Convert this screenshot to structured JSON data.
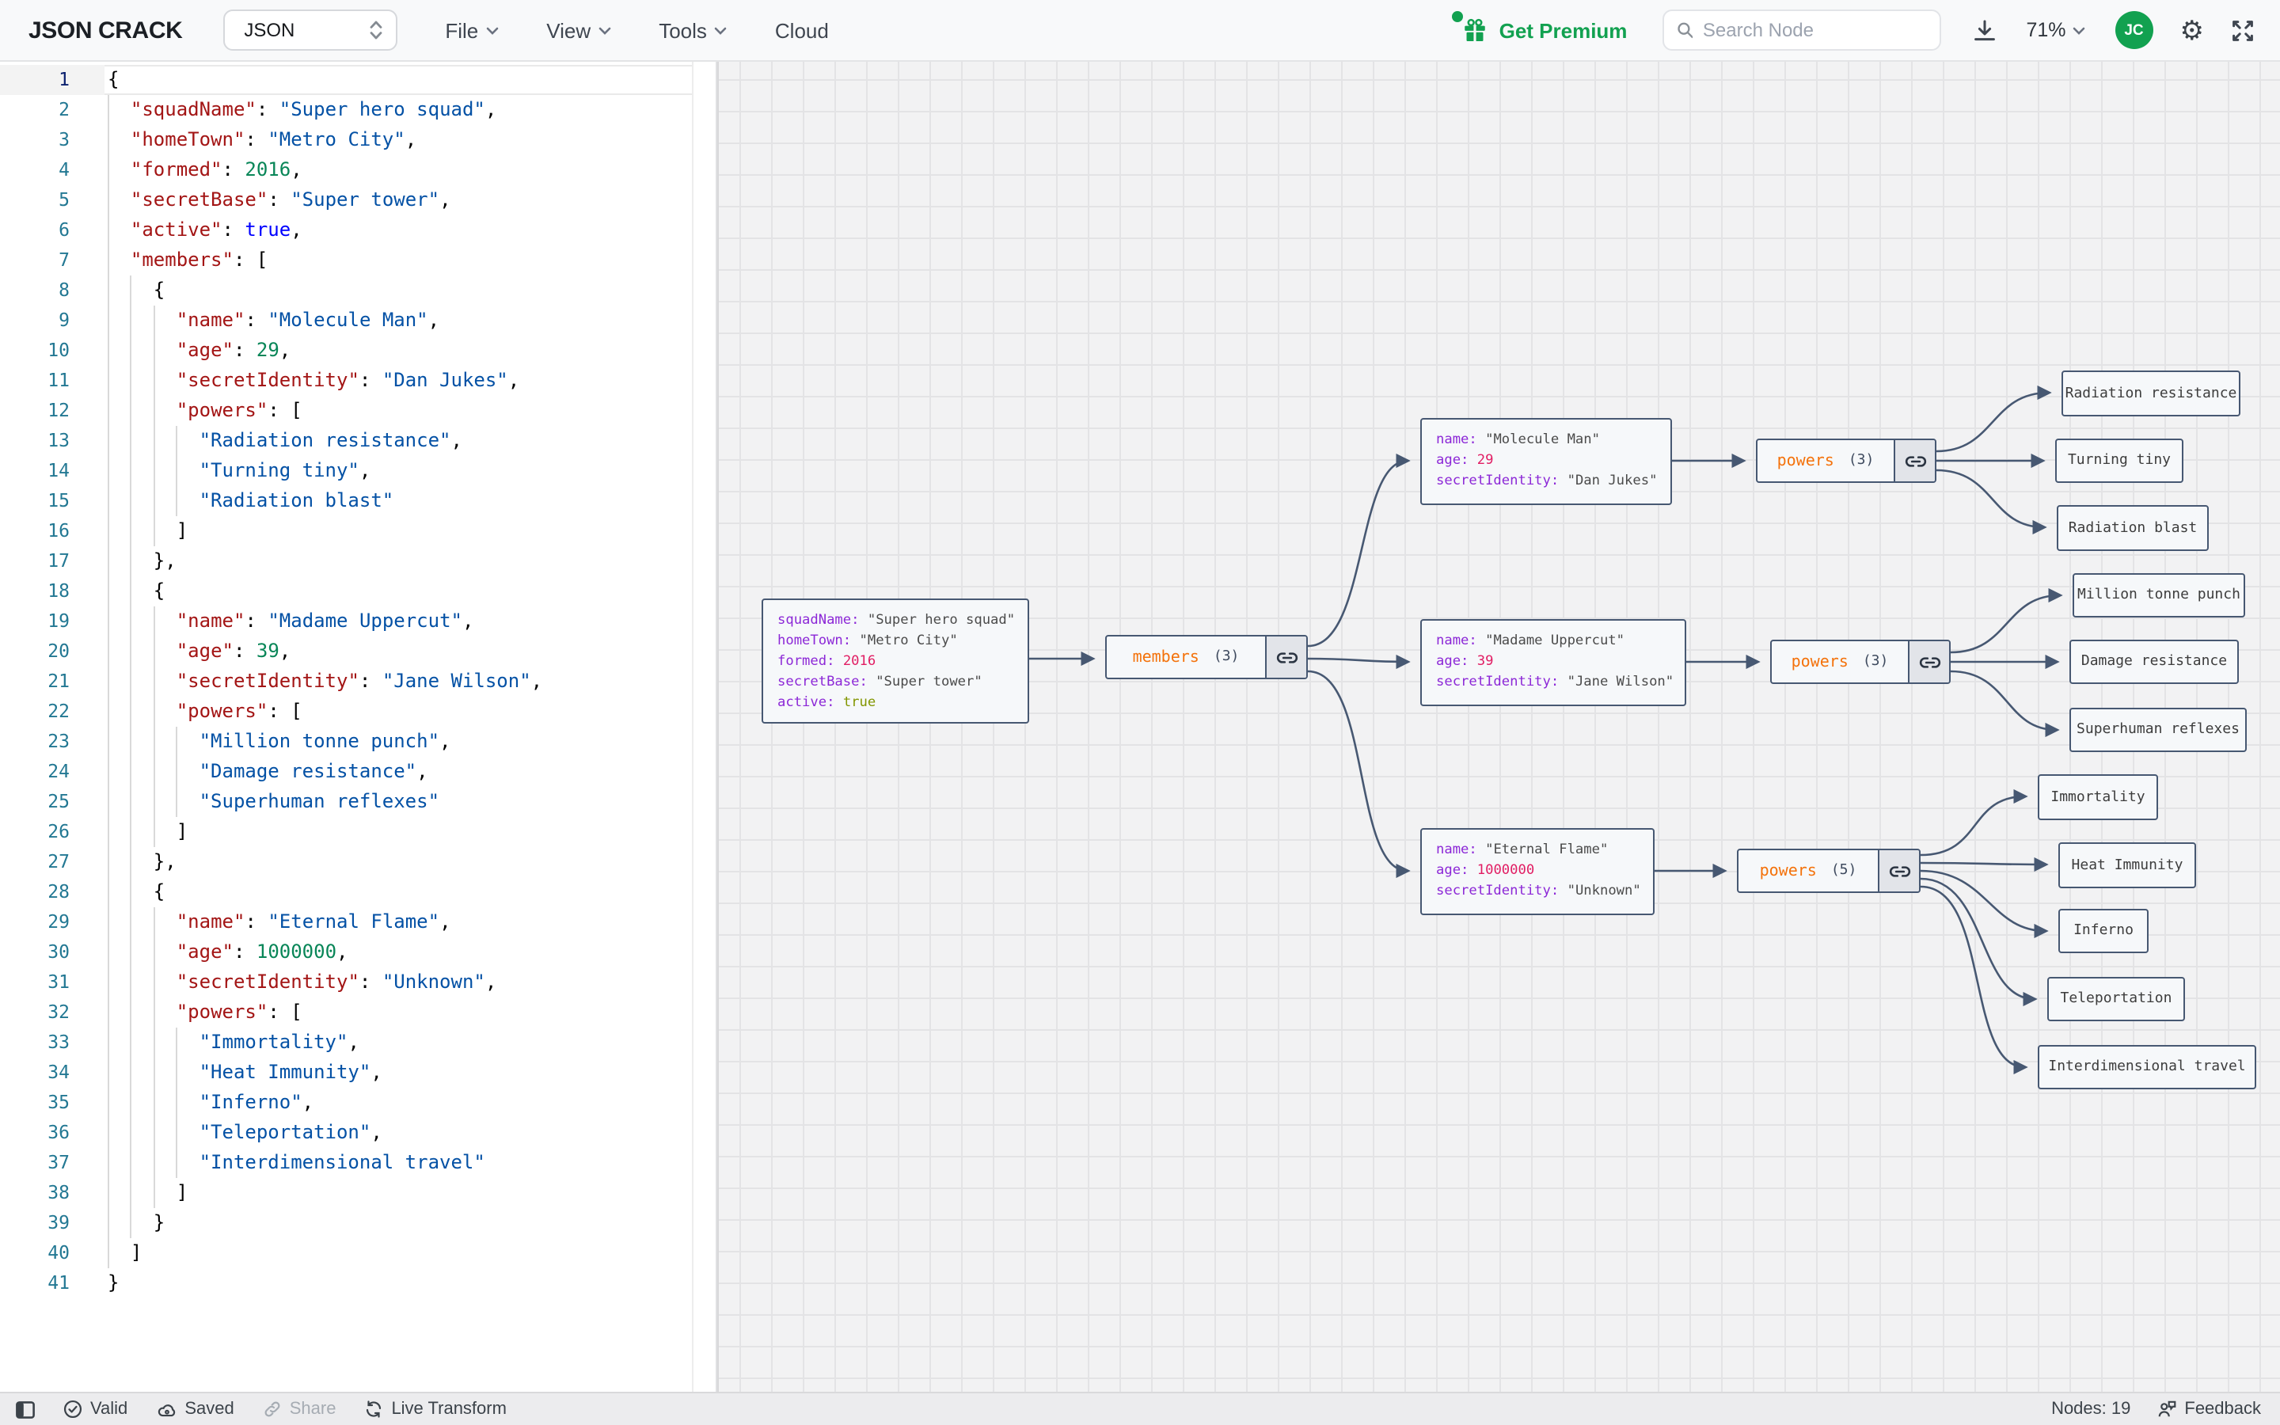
{
  "header": {
    "logo": "JSON CRACK",
    "format_select": {
      "value": "JSON"
    },
    "menus": [
      "File",
      "View",
      "Tools",
      "Cloud"
    ],
    "get_premium": "Get Premium",
    "search": {
      "placeholder": "Search Node"
    },
    "zoom_level": "71%",
    "avatar_initials": "JC"
  },
  "colors": {
    "accent-green": "#12A150",
    "edge-slate": "#475872",
    "node-key": "#8C28D7",
    "node-number": "#E11D63",
    "node-boolean": "#829600",
    "node-array": "#F4720B",
    "ed-key": "#A31515",
    "ed-string": "#0451A5",
    "ed-number": "#098658",
    "ed-keyword": "#0000FF",
    "line-number": "#237893"
  },
  "editor": {
    "lines": [
      {
        "n": 1,
        "t": [
          [
            "p",
            "{"
          ]
        ]
      },
      {
        "n": 2,
        "t": [
          [
            "p",
            "  "
          ],
          [
            "k",
            "\"squadName\""
          ],
          [
            "p",
            ": "
          ],
          [
            "s",
            "\"Super hero squad\""
          ],
          [
            "p",
            ","
          ]
        ]
      },
      {
        "n": 3,
        "t": [
          [
            "p",
            "  "
          ],
          [
            "k",
            "\"homeTown\""
          ],
          [
            "p",
            ": "
          ],
          [
            "s",
            "\"Metro City\""
          ],
          [
            "p",
            ","
          ]
        ]
      },
      {
        "n": 4,
        "t": [
          [
            "p",
            "  "
          ],
          [
            "k",
            "\"formed\""
          ],
          [
            "p",
            ": "
          ],
          [
            "n",
            "2016"
          ],
          [
            "p",
            ","
          ]
        ]
      },
      {
        "n": 5,
        "t": [
          [
            "p",
            "  "
          ],
          [
            "k",
            "\"secretBase\""
          ],
          [
            "p",
            ": "
          ],
          [
            "s",
            "\"Super tower\""
          ],
          [
            "p",
            ","
          ]
        ]
      },
      {
        "n": 6,
        "t": [
          [
            "p",
            "  "
          ],
          [
            "k",
            "\"active\""
          ],
          [
            "p",
            ": "
          ],
          [
            "b",
            "true"
          ],
          [
            "p",
            ","
          ]
        ]
      },
      {
        "n": 7,
        "t": [
          [
            "p",
            "  "
          ],
          [
            "k",
            "\"members\""
          ],
          [
            "p",
            ": ["
          ]
        ]
      },
      {
        "n": 8,
        "t": [
          [
            "p",
            "    {"
          ]
        ]
      },
      {
        "n": 9,
        "t": [
          [
            "p",
            "      "
          ],
          [
            "k",
            "\"name\""
          ],
          [
            "p",
            ": "
          ],
          [
            "s",
            "\"Molecule Man\""
          ],
          [
            "p",
            ","
          ]
        ]
      },
      {
        "n": 10,
        "t": [
          [
            "p",
            "      "
          ],
          [
            "k",
            "\"age\""
          ],
          [
            "p",
            ": "
          ],
          [
            "n",
            "29"
          ],
          [
            "p",
            ","
          ]
        ]
      },
      {
        "n": 11,
        "t": [
          [
            "p",
            "      "
          ],
          [
            "k",
            "\"secretIdentity\""
          ],
          [
            "p",
            ": "
          ],
          [
            "s",
            "\"Dan Jukes\""
          ],
          [
            "p",
            ","
          ]
        ]
      },
      {
        "n": 12,
        "t": [
          [
            "p",
            "      "
          ],
          [
            "k",
            "\"powers\""
          ],
          [
            "p",
            ": ["
          ]
        ]
      },
      {
        "n": 13,
        "t": [
          [
            "p",
            "        "
          ],
          [
            "s",
            "\"Radiation resistance\""
          ],
          [
            "p",
            ","
          ]
        ]
      },
      {
        "n": 14,
        "t": [
          [
            "p",
            "        "
          ],
          [
            "s",
            "\"Turning tiny\""
          ],
          [
            "p",
            ","
          ]
        ]
      },
      {
        "n": 15,
        "t": [
          [
            "p",
            "        "
          ],
          [
            "s",
            "\"Radiation blast\""
          ]
        ]
      },
      {
        "n": 16,
        "t": [
          [
            "p",
            "      ]"
          ]
        ]
      },
      {
        "n": 17,
        "t": [
          [
            "p",
            "    },"
          ]
        ]
      },
      {
        "n": 18,
        "t": [
          [
            "p",
            "    {"
          ]
        ]
      },
      {
        "n": 19,
        "t": [
          [
            "p",
            "      "
          ],
          [
            "k",
            "\"name\""
          ],
          [
            "p",
            ": "
          ],
          [
            "s",
            "\"Madame Uppercut\""
          ],
          [
            "p",
            ","
          ]
        ]
      },
      {
        "n": 20,
        "t": [
          [
            "p",
            "      "
          ],
          [
            "k",
            "\"age\""
          ],
          [
            "p",
            ": "
          ],
          [
            "n",
            "39"
          ],
          [
            "p",
            ","
          ]
        ]
      },
      {
        "n": 21,
        "t": [
          [
            "p",
            "      "
          ],
          [
            "k",
            "\"secretIdentity\""
          ],
          [
            "p",
            ": "
          ],
          [
            "s",
            "\"Jane Wilson\""
          ],
          [
            "p",
            ","
          ]
        ]
      },
      {
        "n": 22,
        "t": [
          [
            "p",
            "      "
          ],
          [
            "k",
            "\"powers\""
          ],
          [
            "p",
            ": ["
          ]
        ]
      },
      {
        "n": 23,
        "t": [
          [
            "p",
            "        "
          ],
          [
            "s",
            "\"Million tonne punch\""
          ],
          [
            "p",
            ","
          ]
        ]
      },
      {
        "n": 24,
        "t": [
          [
            "p",
            "        "
          ],
          [
            "s",
            "\"Damage resistance\""
          ],
          [
            "p",
            ","
          ]
        ]
      },
      {
        "n": 25,
        "t": [
          [
            "p",
            "        "
          ],
          [
            "s",
            "\"Superhuman reflexes\""
          ]
        ]
      },
      {
        "n": 26,
        "t": [
          [
            "p",
            "      ]"
          ]
        ]
      },
      {
        "n": 27,
        "t": [
          [
            "p",
            "    },"
          ]
        ]
      },
      {
        "n": 28,
        "t": [
          [
            "p",
            "    {"
          ]
        ]
      },
      {
        "n": 29,
        "t": [
          [
            "p",
            "      "
          ],
          [
            "k",
            "\"name\""
          ],
          [
            "p",
            ": "
          ],
          [
            "s",
            "\"Eternal Flame\""
          ],
          [
            "p",
            ","
          ]
        ]
      },
      {
        "n": 30,
        "t": [
          [
            "p",
            "      "
          ],
          [
            "k",
            "\"age\""
          ],
          [
            "p",
            ": "
          ],
          [
            "n",
            "1000000"
          ],
          [
            "p",
            ","
          ]
        ]
      },
      {
        "n": 31,
        "t": [
          [
            "p",
            "      "
          ],
          [
            "k",
            "\"secretIdentity\""
          ],
          [
            "p",
            ": "
          ],
          [
            "s",
            "\"Unknown\""
          ],
          [
            "p",
            ","
          ]
        ]
      },
      {
        "n": 32,
        "t": [
          [
            "p",
            "      "
          ],
          [
            "k",
            "\"powers\""
          ],
          [
            "p",
            ": ["
          ]
        ]
      },
      {
        "n": 33,
        "t": [
          [
            "p",
            "        "
          ],
          [
            "s",
            "\"Immortality\""
          ],
          [
            "p",
            ","
          ]
        ]
      },
      {
        "n": 34,
        "t": [
          [
            "p",
            "        "
          ],
          [
            "s",
            "\"Heat Immunity\""
          ],
          [
            "p",
            ","
          ]
        ]
      },
      {
        "n": 35,
        "t": [
          [
            "p",
            "        "
          ],
          [
            "s",
            "\"Inferno\""
          ],
          [
            "p",
            ","
          ]
        ]
      },
      {
        "n": 36,
        "t": [
          [
            "p",
            "        "
          ],
          [
            "s",
            "\"Teleportation\""
          ],
          [
            "p",
            ","
          ]
        ]
      },
      {
        "n": 37,
        "t": [
          [
            "p",
            "        "
          ],
          [
            "s",
            "\"Interdimensional travel\""
          ]
        ]
      },
      {
        "n": 38,
        "t": [
          [
            "p",
            "      ]"
          ]
        ]
      },
      {
        "n": 39,
        "t": [
          [
            "p",
            "    }"
          ]
        ]
      },
      {
        "n": 40,
        "t": [
          [
            "p",
            "  ]"
          ]
        ]
      },
      {
        "n": 41,
        "t": [
          [
            "p",
            "}"
          ]
        ]
      }
    ]
  },
  "graph": {
    "nodes": [
      {
        "id": "root",
        "kind": "object",
        "rows": [
          {
            "k": "squadName:",
            "v": "\"Super hero squad\"",
            "t": "s"
          },
          {
            "k": "homeTown:",
            "v": "\"Metro City\"",
            "t": "s"
          },
          {
            "k": "formed:",
            "v": "2016",
            "t": "n"
          },
          {
            "k": "secretBase:",
            "v": "\"Super tower\"",
            "t": "s"
          },
          {
            "k": "active:",
            "v": "true",
            "t": "b"
          }
        ]
      },
      {
        "id": "members",
        "kind": "array",
        "label": "members",
        "count": "(3)"
      },
      {
        "id": "hero1",
        "kind": "object",
        "rows": [
          {
            "k": "name:",
            "v": "\"Molecule Man\"",
            "t": "s"
          },
          {
            "k": "age:",
            "v": "29",
            "t": "n"
          },
          {
            "k": "secretIdentity:",
            "v": "\"Dan Jukes\"",
            "t": "s"
          }
        ]
      },
      {
        "id": "powers1",
        "kind": "array",
        "label": "powers",
        "count": "(3)"
      },
      {
        "id": "leaf11",
        "kind": "leaf",
        "text": "Radiation resistance"
      },
      {
        "id": "leaf12",
        "kind": "leaf",
        "text": "Turning tiny"
      },
      {
        "id": "leaf13",
        "kind": "leaf",
        "text": "Radiation blast"
      },
      {
        "id": "hero2",
        "kind": "object",
        "rows": [
          {
            "k": "name:",
            "v": "\"Madame Uppercut\"",
            "t": "s"
          },
          {
            "k": "age:",
            "v": "39",
            "t": "n"
          },
          {
            "k": "secretIdentity:",
            "v": "\"Jane Wilson\"",
            "t": "s"
          }
        ]
      },
      {
        "id": "powers2",
        "kind": "array",
        "label": "powers",
        "count": "(3)"
      },
      {
        "id": "leaf21",
        "kind": "leaf",
        "text": "Million tonne punch"
      },
      {
        "id": "leaf22",
        "kind": "leaf",
        "text": "Damage resistance"
      },
      {
        "id": "leaf23",
        "kind": "leaf",
        "text": "Superhuman reflexes"
      },
      {
        "id": "hero3",
        "kind": "object",
        "rows": [
          {
            "k": "name:",
            "v": "\"Eternal Flame\"",
            "t": "s"
          },
          {
            "k": "age:",
            "v": "1000000",
            "t": "n"
          },
          {
            "k": "secretIdentity:",
            "v": "\"Unknown\"",
            "t": "s"
          }
        ]
      },
      {
        "id": "powers3",
        "kind": "array",
        "label": "powers",
        "count": "(5)"
      },
      {
        "id": "leaf31",
        "kind": "leaf",
        "text": "Immortality"
      },
      {
        "id": "leaf32",
        "kind": "leaf",
        "text": "Heat Immunity"
      },
      {
        "id": "leaf33",
        "kind": "leaf",
        "text": "Inferno"
      },
      {
        "id": "leaf34",
        "kind": "leaf",
        "text": "Teleportation"
      },
      {
        "id": "leaf35",
        "kind": "leaf",
        "text": "Interdimensional travel"
      }
    ]
  },
  "statusbar": {
    "valid": "Valid",
    "saved": "Saved",
    "share": "Share",
    "live_transform": "Live Transform",
    "nodes_count": "Nodes: 19",
    "feedback": "Feedback"
  }
}
